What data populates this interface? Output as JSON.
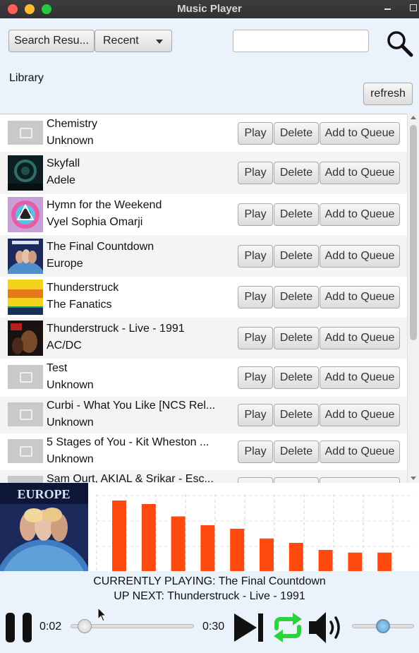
{
  "window": {
    "title": "Music Player"
  },
  "toolbar": {
    "search_mode_label": "Search Resu...",
    "sort_selected": "Recent",
    "search_placeholder": "",
    "refresh_label": "refresh"
  },
  "library_label": "Library",
  "row_buttons": {
    "play": "Play",
    "delete": "Delete",
    "queue": "Add to Queue"
  },
  "songs": [
    {
      "title": "Chemistry",
      "artist": "Unknown",
      "art": "placeholder"
    },
    {
      "title": "Skyfall",
      "artist": "Adele",
      "art": "skyfall-cover"
    },
    {
      "title": "Hymn for the Weekend",
      "artist": "Vyel Sophia Omarji",
      "art": "hymn-cover"
    },
    {
      "title": "The Final Countdown",
      "artist": "Europe",
      "art": "europe-cover"
    },
    {
      "title": "Thunderstruck",
      "artist": "The Fanatics",
      "art": "ultimate-sports-cover"
    },
    {
      "title": "Thunderstruck - Live - 1991",
      "artist": "AC/DC",
      "art": "acdc-cover"
    },
    {
      "title": "Test",
      "artist": "Unknown",
      "art": "placeholder"
    },
    {
      "title": "Curbi - What You Like [NCS Rel...",
      "artist": "Unknown",
      "art": "placeholder"
    },
    {
      "title": "5 Stages of You - Kit Wheston ...",
      "artist": "Unknown",
      "art": "placeholder"
    },
    {
      "title": "Sam Ourt, AKIAL & Srikar - Esc...",
      "artist": "",
      "art": "placeholder"
    }
  ],
  "album_art_text": "EUROPE",
  "visualizer": {
    "bar_color": "#ff4a0f",
    "levels": [
      0.8,
      0.76,
      0.62,
      0.52,
      0.48,
      0.37,
      0.32,
      0.24,
      0.21,
      0.21
    ]
  },
  "now_playing": {
    "current": "CURRENTLY PLAYING: The Final Countdown",
    "next": "UP NEXT: Thunderstruck - Live - 1991"
  },
  "transport": {
    "elapsed": "0:02",
    "total": "0:30",
    "progress": 0.1,
    "volume": 0.5,
    "repeat_color": "#2ad43a"
  }
}
